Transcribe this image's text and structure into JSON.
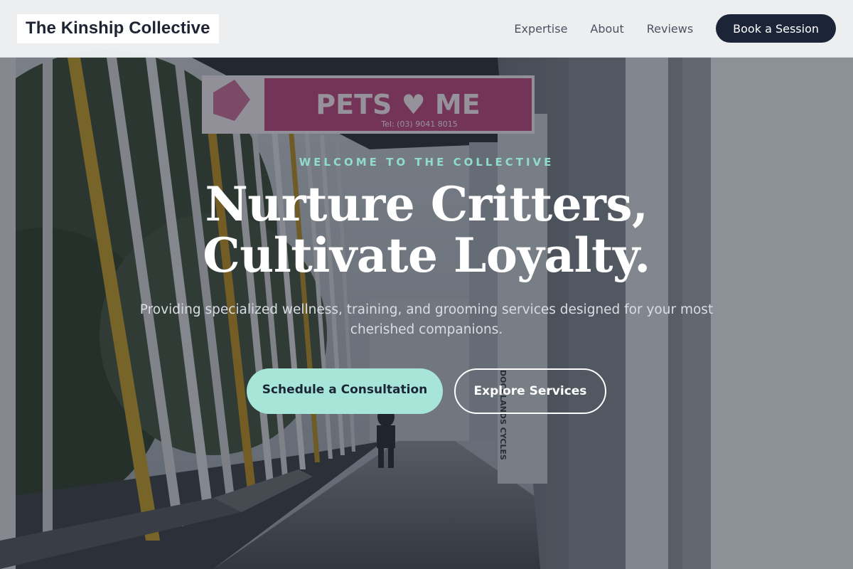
{
  "header": {
    "brand": "The Kinship Collective",
    "nav": [
      "Expertise",
      "About",
      "Reviews"
    ],
    "cta": "Book a Session"
  },
  "hero": {
    "eyebrow": "WELCOME TO THE COLLECTIVE",
    "headline_line1": "Nurture Critters,",
    "headline_line2": "Cultivate Loyalty.",
    "subtitle": "Providing specialized wellness, training, and grooming services designed for your most cherished companions.",
    "primary_button": "Schedule a Consultation",
    "secondary_button": "Explore Services"
  },
  "background": {
    "shop_sign": "PETS ME",
    "shop_phone": "Tel: (03) 9041 8015",
    "column_sign": "DOCKLANDS CYCLES"
  },
  "colors": {
    "accent": "#a6e5d8",
    "eyebrow": "#8fdccb",
    "navy": "#1c2538",
    "sign_pink": "#b8487a"
  }
}
